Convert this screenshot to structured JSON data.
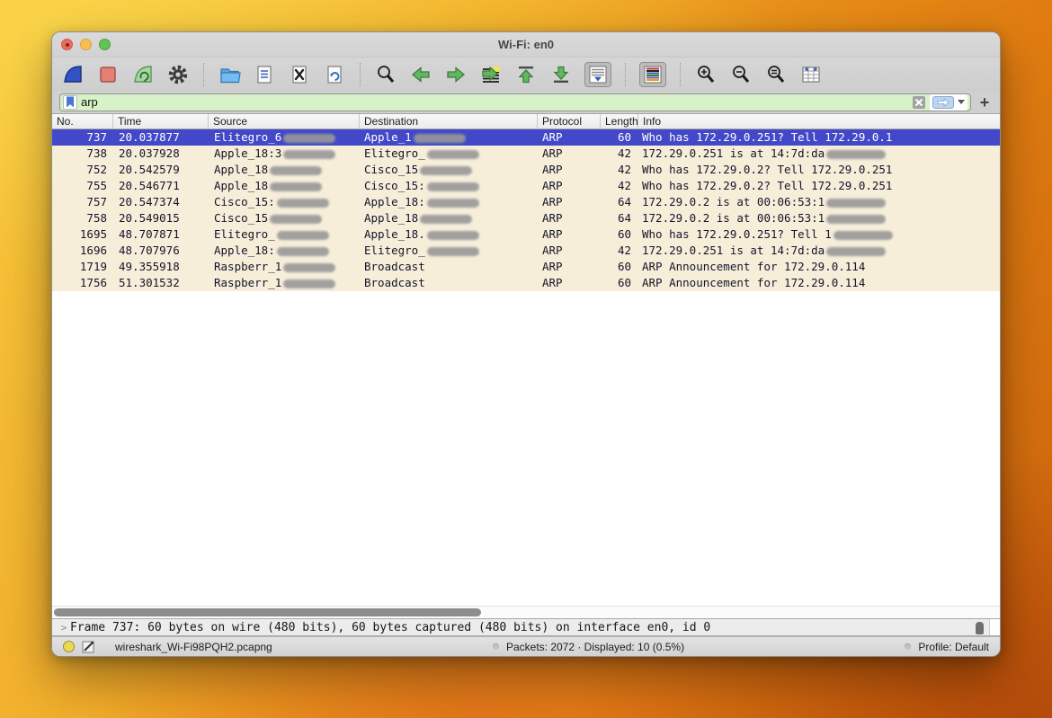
{
  "window": {
    "title": "Wi-Fi: en0"
  },
  "toolbar": {
    "icons": [
      "start-capture-fin",
      "stop-capture",
      "restart-capture-fin",
      "capture-options-gear",
      "open-file-folder",
      "save-file-doc",
      "close-file-doc",
      "reload-file-doc",
      "find-packet-magnifier",
      "go-back-arrow",
      "go-forward-arrow",
      "go-to-packet",
      "go-to-top-arrow",
      "go-to-bottom-arrow",
      "auto-scroll",
      "colorize-packets",
      "zoom-in-magnifier",
      "zoom-out-magnifier",
      "zoom-reset-magnifier",
      "resize-columns"
    ]
  },
  "filter": {
    "value": "arp",
    "add_button_glyph": "+"
  },
  "table": {
    "columns": [
      "No.",
      "Time",
      "Source",
      "Destination",
      "Protocol",
      "Length",
      "Info"
    ],
    "rows": [
      {
        "no": "737",
        "time": "20.037877",
        "source": "Elitegro_6",
        "source_redacted": true,
        "destination": "Apple_1",
        "destination_redacted": true,
        "protocol": "ARP",
        "length": "60",
        "info": "Who has 172.29.0.251? Tell 172.29.0.1",
        "info_redacted": false,
        "selected": true
      },
      {
        "no": "738",
        "time": "20.037928",
        "source": "Apple_18:3",
        "source_redacted": true,
        "destination": "Elitegro_",
        "destination_redacted": true,
        "protocol": "ARP",
        "length": "42",
        "info": "172.29.0.251 is at 14:7d:da",
        "info_redacted": true,
        "selected": false
      },
      {
        "no": "752",
        "time": "20.542579",
        "source": "Apple_18",
        "source_redacted": true,
        "destination": "Cisco_15",
        "destination_redacted": true,
        "protocol": "ARP",
        "length": "42",
        "info": "Who has 172.29.0.2? Tell 172.29.0.251",
        "info_redacted": false,
        "selected": false
      },
      {
        "no": "755",
        "time": "20.546771",
        "source": "Apple_18",
        "source_redacted": true,
        "destination": "Cisco_15:",
        "destination_redacted": true,
        "protocol": "ARP",
        "length": "42",
        "info": "Who has 172.29.0.2? Tell 172.29.0.251",
        "info_redacted": false,
        "selected": false
      },
      {
        "no": "757",
        "time": "20.547374",
        "source": "Cisco_15:",
        "source_redacted": true,
        "destination": "Apple_18:",
        "destination_redacted": true,
        "protocol": "ARP",
        "length": "64",
        "info": "172.29.0.2 is at 00:06:53:1",
        "info_redacted": true,
        "selected": false
      },
      {
        "no": "758",
        "time": "20.549015",
        "source": "Cisco_15",
        "source_redacted": true,
        "destination": "Apple_18",
        "destination_redacted": true,
        "protocol": "ARP",
        "length": "64",
        "info": "172.29.0.2 is at 00:06:53:1",
        "info_redacted": true,
        "selected": false
      },
      {
        "no": "1695",
        "time": "48.707871",
        "source": "Elitegro_",
        "source_redacted": true,
        "destination": "Apple_18.",
        "destination_redacted": true,
        "protocol": "ARP",
        "length": "60",
        "info": "Who has 172.29.0.251? Tell 1",
        "info_redacted": true,
        "selected": false
      },
      {
        "no": "1696",
        "time": "48.707976",
        "source": "Apple_18:",
        "source_redacted": true,
        "destination": "Elitegro_",
        "destination_redacted": true,
        "protocol": "ARP",
        "length": "42",
        "info": "172.29.0.251 is at 14:7d:da",
        "info_redacted": true,
        "selected": false
      },
      {
        "no": "1719",
        "time": "49.355918",
        "source": "Raspberr_1",
        "source_redacted": true,
        "destination": "Broadcast",
        "destination_redacted": false,
        "protocol": "ARP",
        "length": "60",
        "info": "ARP Announcement for 172.29.0.114",
        "info_redacted": false,
        "selected": false
      },
      {
        "no": "1756",
        "time": "51.301532",
        "source": "Raspberr_1",
        "source_redacted": true,
        "destination": "Broadcast",
        "destination_redacted": false,
        "protocol": "ARP",
        "length": "60",
        "info": "ARP Announcement for 172.29.0.114",
        "info_redacted": false,
        "selected": false
      }
    ]
  },
  "detail": {
    "expander_glyph": ">",
    "text": "Frame 737: 60 bytes on wire (480 bits), 60 bytes captured (480 bits) on interface en0, id 0"
  },
  "status": {
    "filename": "wireshark_Wi-Fi98PQH2.pcapng",
    "packets": "Packets: 2072 · Displayed: 10 (0.5%)",
    "profile": "Profile: Default"
  },
  "colors": {
    "selected_row": "#4348c8",
    "arp_row_background": "#f7eeda",
    "filter_valid_green": "#d6f2c6",
    "accent_green_arrow": "#61b861",
    "wireshark_fin_blue": "#3252c6"
  }
}
